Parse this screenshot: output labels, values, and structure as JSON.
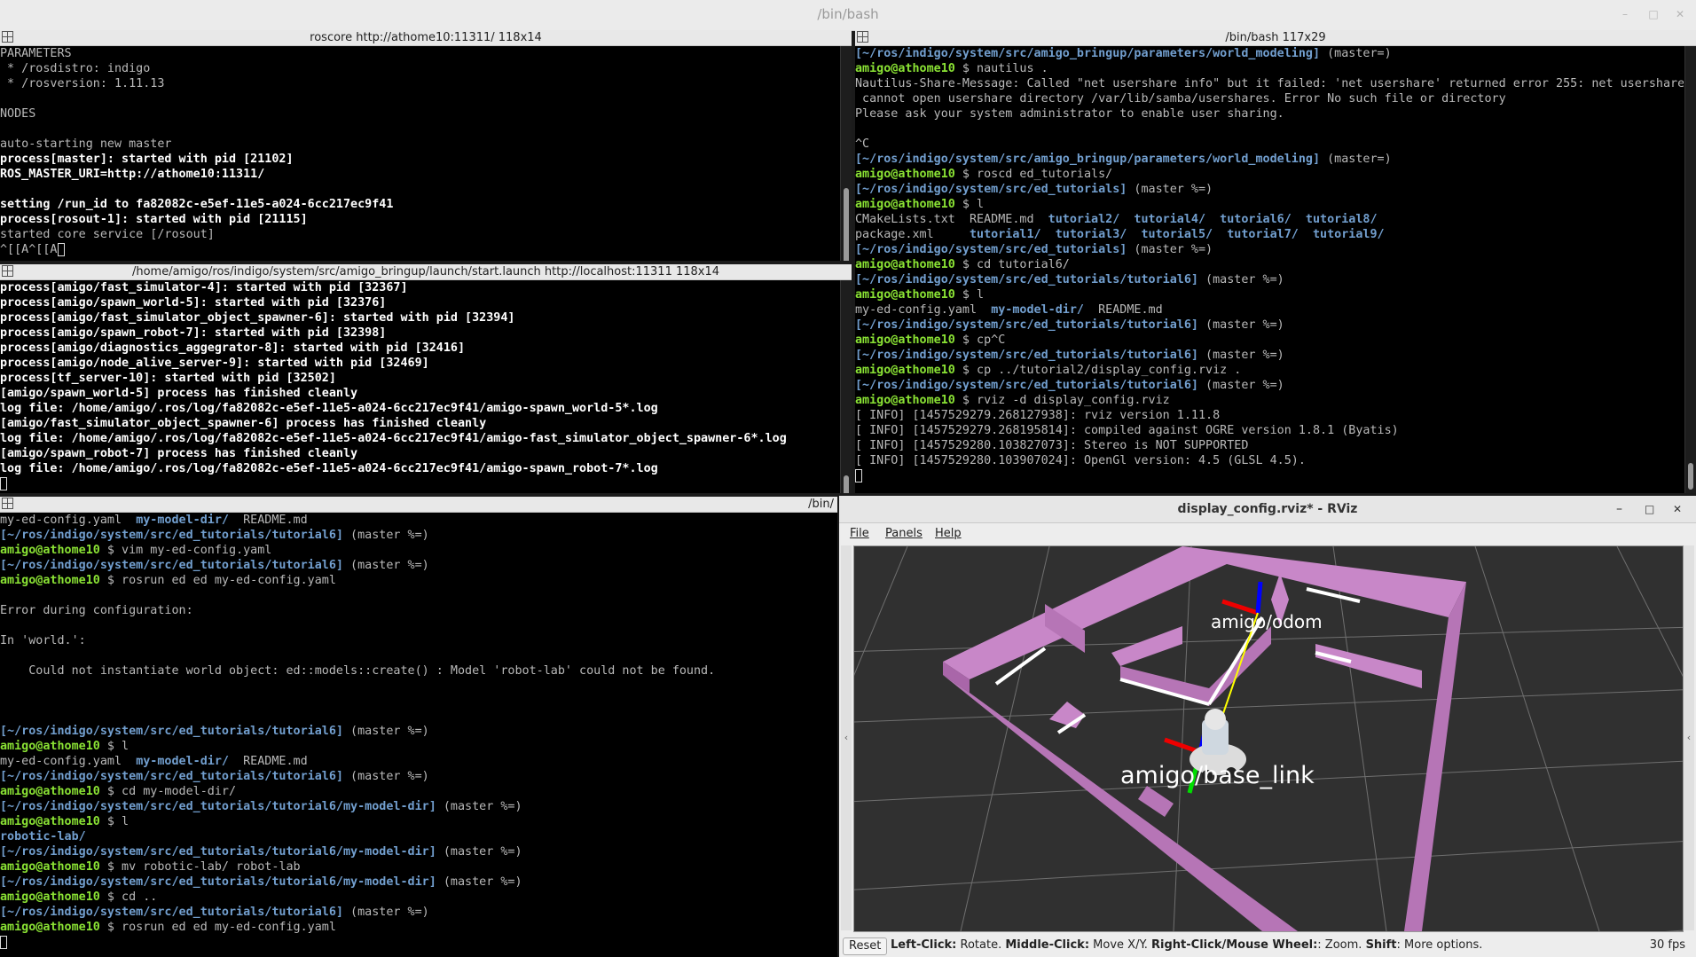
{
  "window": {
    "title": "/bin/bash",
    "min_icon": "minimize-icon",
    "max_icon": "maximize-icon",
    "close_icon": "close-icon"
  },
  "pane_roscore": {
    "title": "roscore http://athome10:11311/ 118x14",
    "lines": [
      "PARAMETERS",
      " * /rosdistro: indigo",
      " * /rosversion: 1.11.13",
      "",
      "NODES",
      "",
      "auto-starting new master",
      "process[master]: started with pid [21102]",
      "ROS_MASTER_URI=http://athome10:11311/",
      "",
      "setting /run_id to fa82082c-e5ef-11e5-a024-6cc217ec9f41",
      "process[rosout-1]: started with pid [21115]",
      "started core service [/rosout]",
      "^[[A^[[A"
    ]
  },
  "pane_launch": {
    "title": "/home/amigo/ros/indigo/system/src/amigo_bringup/launch/start.launch http://localhost:11311 118x14",
    "lines": [
      "process[amigo/fast_simulator-4]: started with pid [32367]",
      "process[amigo/spawn_world-5]: started with pid [32376]",
      "process[amigo/fast_simulator_object_spawner-6]: started with pid [32394]",
      "process[amigo/spawn_robot-7]: started with pid [32398]",
      "process[amigo/diagnostics_aggegrator-8]: started with pid [32416]",
      "process[amigo/node_alive_server-9]: started with pid [32469]",
      "process[tf_server-10]: started with pid [32502]",
      "[amigo/spawn_world-5] process has finished cleanly",
      "log file: /home/amigo/.ros/log/fa82082c-e5ef-11e5-a024-6cc217ec9f41/amigo-spawn_world-5*.log",
      "[amigo/fast_simulator_object_spawner-6] process has finished cleanly",
      "log file: /home/amigo/.ros/log/fa82082c-e5ef-11e5-a024-6cc217ec9f41/amigo-fast_simulator_object_spawner-6*.log",
      "[amigo/spawn_robot-7] process has finished cleanly",
      "log file: /home/amigo/.ros/log/fa82082c-e5ef-11e5-a024-6cc217ec9f41/amigo-spawn_robot-7*.log",
      ""
    ]
  },
  "pane_right": {
    "title": "/bin/bash 117x29",
    "prompt_user": "amigo@athome10",
    "lines": [
      {
        "path": "[~/ros/indigo/system/src/amigo_bringup/parameters/world_modeling]",
        "branch": " (master=)"
      },
      {
        "cmd": " $ nautilus ."
      },
      {
        "text": "Nautilus-Share-Message: Called \"net usershare info\" but it failed: 'net usershare' returned error 255: net usershare:"
      },
      {
        "text": " cannot open usershare directory /var/lib/samba/usershares. Error No such file or directory"
      },
      {
        "text": "Please ask your system administrator to enable user sharing."
      },
      {
        "text": ""
      },
      {
        "text": "^C"
      },
      {
        "path": "[~/ros/indigo/system/src/amigo_bringup/parameters/world_modeling]",
        "branch": " (master=)"
      },
      {
        "cmd": " $ roscd ed_tutorials/"
      },
      {
        "path": "[~/ros/indigo/system/src/ed_tutorials]",
        "branch": " (master %=)"
      },
      {
        "cmd": " $ l"
      },
      {
        "ls": [
          "CMakeLists.txt  README.md  ",
          "tutorial2/",
          "  ",
          "tutorial4/",
          "  ",
          "tutorial6/",
          "  ",
          "tutorial8/"
        ]
      },
      {
        "ls": [
          "package.xml     ",
          "tutorial1/",
          "  ",
          "tutorial3/",
          "  ",
          "tutorial5/",
          "  ",
          "tutorial7/",
          "  ",
          "tutorial9/"
        ]
      },
      {
        "path": "[~/ros/indigo/system/src/ed_tutorials]",
        "branch": " (master %=)"
      },
      {
        "cmd": " $ cd tutorial6/"
      },
      {
        "path": "[~/ros/indigo/system/src/ed_tutorials/tutorial6]",
        "branch": " (master %=)"
      },
      {
        "cmd": " $ l"
      },
      {
        "ls": [
          "my-ed-config.yaml  ",
          "my-model-dir/",
          "  README.md"
        ]
      },
      {
        "path": "[~/ros/indigo/system/src/ed_tutorials/tutorial6]",
        "branch": " (master %=)"
      },
      {
        "cmd": " $ cp^C"
      },
      {
        "path": "[~/ros/indigo/system/src/ed_tutorials/tutorial6]",
        "branch": " (master %=)"
      },
      {
        "cmd": " $ cp ../tutorial2/display_config.rviz ."
      },
      {
        "path": "[~/ros/indigo/system/src/ed_tutorials/tutorial6]",
        "branch": " (master %=)"
      },
      {
        "cmd": " $ rviz -d display_config.rviz"
      },
      {
        "text": "[ INFO] [1457529279.268127938]: rviz version 1.11.8"
      },
      {
        "text": "[ INFO] [1457529279.268195814]: compiled against OGRE version 1.8.1 (Byatis)"
      },
      {
        "text": "[ INFO] [1457529280.103827073]: Stereo is NOT SUPPORTED"
      },
      {
        "text": "[ INFO] [1457529280.103907024]: OpenGl version: 4.5 (GLSL 4.5)."
      },
      {
        "cursor": true
      }
    ]
  },
  "pane_bottom": {
    "title": "/bin/",
    "prompt_user": "amigo@athome10",
    "lines": [
      {
        "ls": [
          "my-ed-config.yaml  ",
          "my-model-dir/",
          "  README.md"
        ]
      },
      {
        "path": "[~/ros/indigo/system/src/ed_tutorials/tutorial6]",
        "branch": " (master %=)"
      },
      {
        "cmd": " $ vim my-ed-config.yaml"
      },
      {
        "path": "[~/ros/indigo/system/src/ed_tutorials/tutorial6]",
        "branch": " (master %=)"
      },
      {
        "cmd": " $ rosrun ed ed my-ed-config.yaml"
      },
      {
        "text": ""
      },
      {
        "text": "Error during configuration:"
      },
      {
        "text": ""
      },
      {
        "text": "In 'world.':"
      },
      {
        "text": ""
      },
      {
        "text": "    Could not instantiate world object: ed::models::create() : Model 'robot-lab' could not be found."
      },
      {
        "text": ""
      },
      {
        "text": ""
      },
      {
        "text": ""
      },
      {
        "path": "[~/ros/indigo/system/src/ed_tutorials/tutorial6]",
        "branch": " (master %=)"
      },
      {
        "cmd": " $ l"
      },
      {
        "ls": [
          "my-ed-config.yaml  ",
          "my-model-dir/",
          "  README.md"
        ]
      },
      {
        "path": "[~/ros/indigo/system/src/ed_tutorials/tutorial6]",
        "branch": " (master %=)"
      },
      {
        "cmd": " $ cd my-model-dir/"
      },
      {
        "path": "[~/ros/indigo/system/src/ed_tutorials/tutorial6/my-model-dir]",
        "branch": " (master %=)"
      },
      {
        "cmd": " $ l"
      },
      {
        "ls": [
          "robotic-lab/"
        ]
      },
      {
        "path": "[~/ros/indigo/system/src/ed_tutorials/tutorial6/my-model-dir]",
        "branch": " (master %=)"
      },
      {
        "cmd": " $ mv robotic-lab/ robot-lab"
      },
      {
        "path": "[~/ros/indigo/system/src/ed_tutorials/tutorial6/my-model-dir]",
        "branch": " (master %=)"
      },
      {
        "cmd": " $ cd .."
      },
      {
        "path": "[~/ros/indigo/system/src/ed_tutorials/tutorial6]",
        "branch": " (master %=)"
      },
      {
        "cmd": " $ rosrun ed ed my-ed-config.yaml"
      },
      {
        "cursor": true
      }
    ]
  },
  "rviz": {
    "title": "display_config.rviz* - RViz",
    "menu": [
      "File",
      "Panels",
      "Help"
    ],
    "labels": {
      "odom": "amigo/odom",
      "base": "amigo/base_link"
    },
    "status": {
      "reset": "Reset",
      "hint_parts": [
        {
          "b": "Left-Click:",
          "t": " Rotate. "
        },
        {
          "b": "Middle-Click:",
          "t": " Move X/Y. "
        },
        {
          "b": "Right-Click/Mouse Wheel:",
          "t": ": Zoom. "
        },
        {
          "b": "Shift",
          "t": ": More options."
        }
      ],
      "fps": "30 fps"
    },
    "colors": {
      "walls": "#c887c8",
      "background": "#303030",
      "grid": "#8a8a8a",
      "laser": "#ffffff"
    }
  },
  "colors": {
    "prompt": "#8ae234",
    "path": "#729fcf",
    "terminal_bg": "#000000"
  }
}
